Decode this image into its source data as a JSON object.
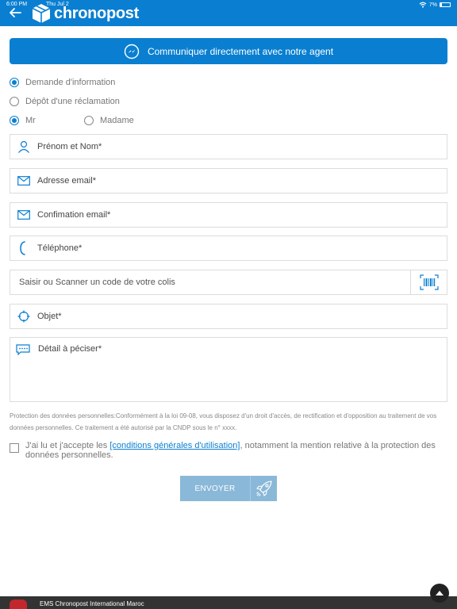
{
  "status_bar": {
    "time": "6:00 PM",
    "date": "Thu Jul 2",
    "battery": "7%",
    "wifi_icon": "wifi-icon"
  },
  "header": {
    "back_icon": "arrow-left-icon",
    "logo_text": "chronopost",
    "logo_icon": "cube-logo-icon"
  },
  "agent_button": {
    "label": "Communiquer directement avec notre agent",
    "icon": "messenger-icon"
  },
  "request_type": {
    "options": [
      "Demande d'information",
      "Dépôt d'une réclamation"
    ],
    "selected": "Demande d'information"
  },
  "civility": {
    "options": [
      "Mr",
      "Madame"
    ],
    "selected": "Mr"
  },
  "fields": {
    "name": {
      "placeholder": "Prénom et Nom*",
      "icon": "user-icon"
    },
    "email": {
      "placeholder": "Adresse email*",
      "icon": "envelope-icon"
    },
    "email_confirm": {
      "placeholder": "Confimation email*",
      "icon": "envelope-icon"
    },
    "phone": {
      "placeholder": "Téléphone*",
      "icon": "phone-icon"
    },
    "tracking": {
      "placeholder": "Saisir ou Scanner un code de votre colis",
      "icon": "barcode-scan-icon"
    },
    "subject": {
      "placeholder": "Objet*",
      "icon": "target-icon"
    },
    "detail": {
      "placeholder": "Détail à péciser*",
      "icon": "chat-dots-icon"
    }
  },
  "privacy_text": "Protection des données personnelles:Conformément à la loi 09-08, vous disposez d'un droit d'accès, de rectification et d'opposition au traitement de vos données personnelles. Ce traitement a été autorisé par la CNDP sous le n° xxxx.",
  "terms": {
    "prefix": "J'ai lu et j'accepte les ",
    "link": "[conditions générales d'utilisation]",
    "suffix": ", notamment la mention relative à la protection des données personnelles.",
    "checked": false
  },
  "submit": {
    "label": "ENVOYER",
    "icon": "rocket-icon"
  },
  "footer": {
    "text": "EMS Chronopost International Maroc",
    "fab_icon": "caret-up-icon"
  },
  "colors": {
    "primary": "#0a7fd1",
    "submit_disabled": "#8ab8d8",
    "footer": "#333333"
  }
}
